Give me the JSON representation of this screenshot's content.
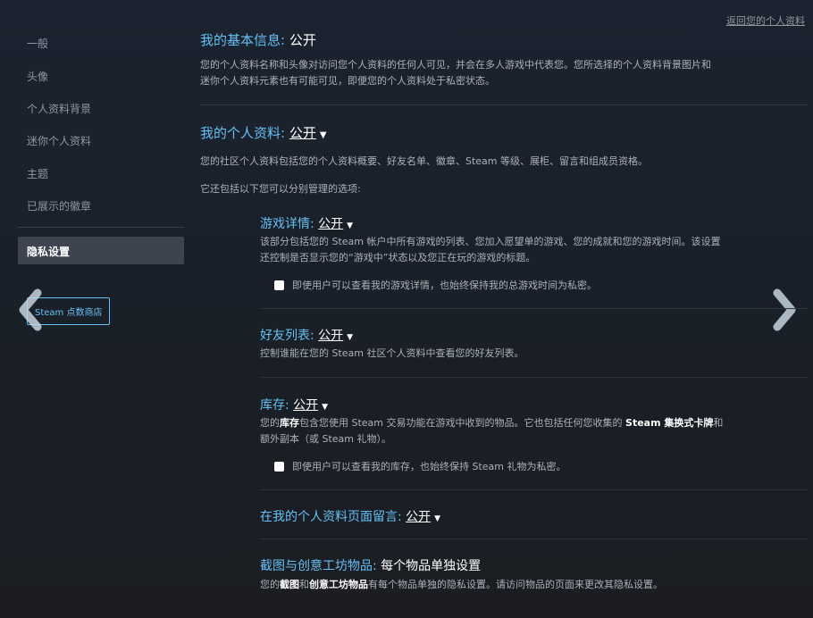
{
  "sidebar": {
    "items": [
      {
        "label": "一般"
      },
      {
        "label": "头像"
      },
      {
        "label": "个人资料背景"
      },
      {
        "label": "迷你个人资料"
      },
      {
        "label": "主题"
      },
      {
        "label": "已展示的徽章"
      }
    ],
    "active": "隐私设置",
    "store_button": "Steam 点数商店"
  },
  "back_link": "返回您的个人资料",
  "basic_info": {
    "title": "我的基本信息:",
    "value": "公开",
    "desc_1": "您的个人资料名称和头像对访问您个人资料的任何人可见，并会在多人游戏中代表您。您所选择的个人资料背景图片和",
    "desc_2": "迷你个人资料元素也有可能可见，即便您的个人资料处于私密状态。"
  },
  "profile": {
    "title": "我的个人资料:",
    "value": "公开",
    "desc": "您的社区个人资料包括您的个人资料概要、好友名单、徽章、Steam 等级、展柜、留言和组成员资格。",
    "note": "它还包括以下您可以分别管理的选项:"
  },
  "game_details": {
    "title": "游戏详情:",
    "value": "公开",
    "desc_1": "该部分包括您的 Steam 帐户中所有游戏的列表、您加入愿望单的游戏、您的成就和您的游戏时间。该设置",
    "desc_2": "还控制是否显示您的“游戏中”状态以及您正在玩的游戏的标题。",
    "checkbox": "即使用户可以查看我的游戏详情，也始终保持我的总游戏时间为私密。"
  },
  "friends_list": {
    "title": "好友列表:",
    "value": "公开",
    "desc": "控制谁能在您的 Steam 社区个人资料中查看您的好友列表。"
  },
  "inventory": {
    "title": "库存:",
    "value": "公开",
    "desc_a": "您的",
    "desc_b": "库存",
    "desc_c": "包含您使用 Steam 交易功能在游戏中收到的物品。它也包括任何您收集的",
    "desc_d": "Steam 集换式卡牌",
    "desc_e": "和",
    "desc_2": "额外副本（或 Steam 礼物）。",
    "checkbox": "即使用户可以查看我的库存，也始终保持 Steam 礼物为私密。"
  },
  "comments": {
    "title": "在我的个人资料页面留言:",
    "value": "公开"
  },
  "screenshots": {
    "title": "截图与创意工坊物品:",
    "value": "每个物品单独设置",
    "desc_a": "您的",
    "desc_b": "截图",
    "desc_c": "和",
    "desc_d": "创意工坊物品",
    "desc_e": "有每个物品单独的隐私设置。请访问物品的页面来更改其隐私设置。"
  },
  "colors": {
    "accent": "#66c0f4",
    "text": "#acb2b8",
    "active_bg": "#3d4450"
  }
}
